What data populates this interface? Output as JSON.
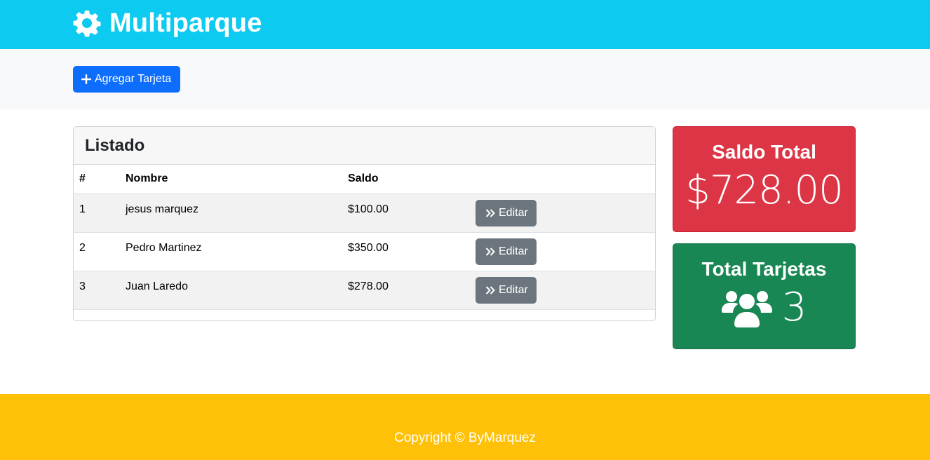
{
  "header": {
    "title": "Multiparque",
    "logo_icon": "gear-icon",
    "background": "#0dcaf0"
  },
  "toolbar": {
    "add_button_label": "Agregar Tarjeta",
    "add_button_icon": "plus-icon",
    "add_button_color": "#0d6efd"
  },
  "listado": {
    "title": "Listado",
    "columns": [
      "#",
      "Nombre",
      "Saldo",
      ""
    ],
    "rows": [
      {
        "num": "1",
        "nombre": "jesus marquez",
        "saldo": "$100.00",
        "action": "Editar"
      },
      {
        "num": "2",
        "nombre": "Pedro Martinez",
        "saldo": "$350.00",
        "action": "Editar"
      },
      {
        "num": "3",
        "nombre": "Juan Laredo",
        "saldo": "$278.00",
        "action": "Editar"
      }
    ],
    "edit_icon": "double-chevron-right-icon"
  },
  "stats": {
    "saldo_total": {
      "title": "Saldo Total",
      "value": "$728.00",
      "color": "#dc3545"
    },
    "total_tarjetas": {
      "title": "Total Tarjetas",
      "value": "3",
      "icon": "users-icon",
      "color": "#198754"
    }
  },
  "footer": {
    "text": "Copyright © ByMarquez",
    "background": "#ffc107"
  }
}
